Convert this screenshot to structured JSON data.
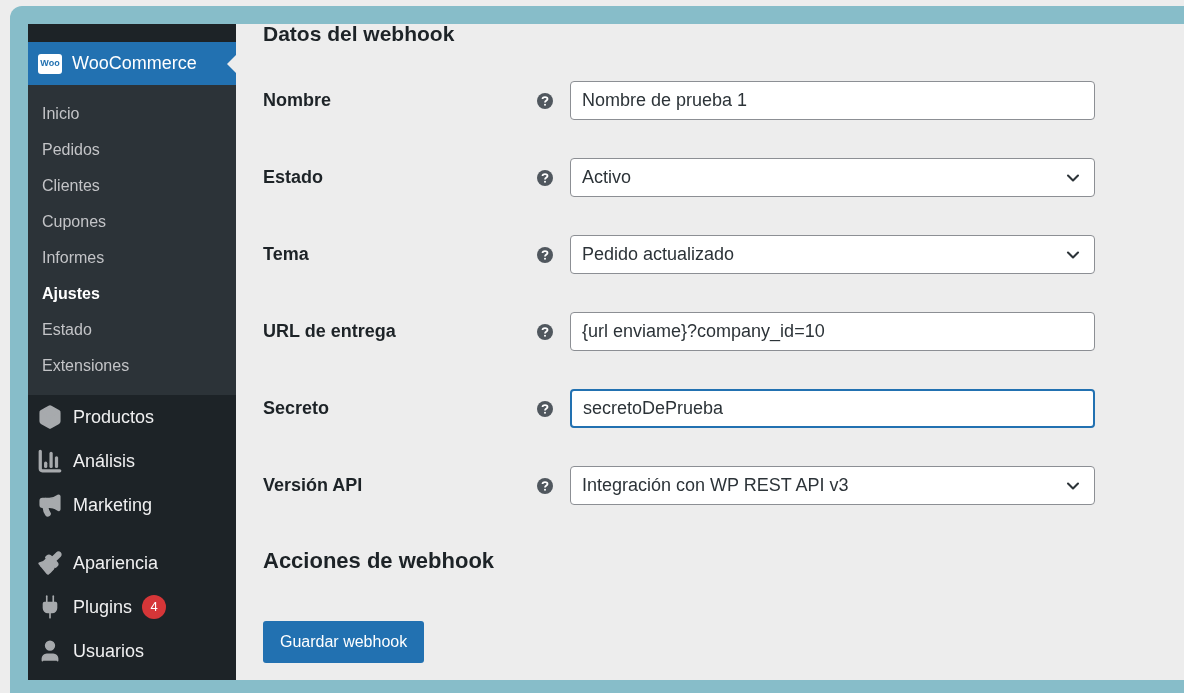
{
  "sidebar": {
    "header": {
      "logo_text": "Woo",
      "label": "WooCommerce",
      "selected": true
    },
    "submenu": [
      {
        "label": "Inicio",
        "selected": false
      },
      {
        "label": "Pedidos",
        "selected": false
      },
      {
        "label": "Clientes",
        "selected": false
      },
      {
        "label": "Cupones",
        "selected": false
      },
      {
        "label": "Informes",
        "selected": false
      },
      {
        "label": "Ajustes",
        "selected": true
      },
      {
        "label": "Estado",
        "selected": false
      },
      {
        "label": "Extensiones",
        "selected": false
      }
    ],
    "menu_groups": [
      [
        {
          "label": "Productos",
          "kind": "products"
        },
        {
          "label": "Análisis",
          "kind": "analytics"
        },
        {
          "label": "Marketing",
          "kind": "marketing"
        }
      ],
      [
        {
          "label": "Apariencia",
          "kind": "appearance"
        },
        {
          "label": "Plugins",
          "kind": "plugins",
          "badge": "4"
        },
        {
          "label": "Usuarios",
          "kind": "users"
        }
      ]
    ]
  },
  "form": {
    "title": "Datos del webhook",
    "fields": [
      {
        "label": "Nombre",
        "kind": "text",
        "value": "Nombre de prueba 1",
        "focused": false
      },
      {
        "label": "Estado",
        "kind": "select",
        "value": "Activo",
        "focused": false
      },
      {
        "label": "Tema",
        "kind": "select",
        "value": "Pedido actualizado",
        "focused": false
      },
      {
        "label": "URL de entrega",
        "kind": "text",
        "value": "{url enviame}?company_id=10",
        "focused": false
      },
      {
        "label": "Secreto",
        "kind": "text",
        "value": "secretoDePrueba",
        "focused": true
      },
      {
        "label": "Versión API",
        "kind": "select",
        "value": "Integración con WP REST API v3",
        "focused": false
      }
    ],
    "actions_title": "Acciones de webhook",
    "save_button": "Guardar webhook"
  }
}
